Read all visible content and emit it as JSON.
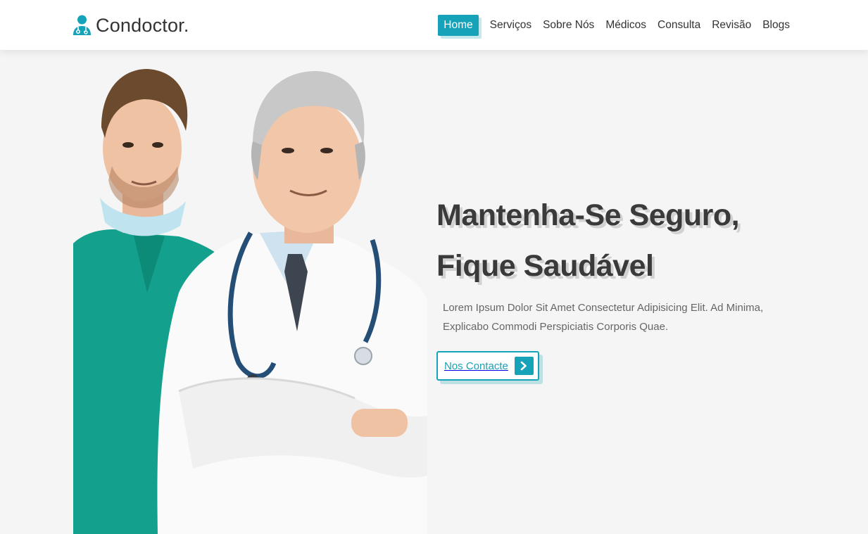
{
  "brand": {
    "name": "Condoctor.",
    "accent_color": "#16a2b8",
    "icon": "doctor-user-icon"
  },
  "nav": {
    "items": [
      {
        "label": "Home",
        "active": true
      },
      {
        "label": "Serviços",
        "active": false
      },
      {
        "label": "Sobre Nós",
        "active": false
      },
      {
        "label": "Médicos",
        "active": false
      },
      {
        "label": "Consulta",
        "active": false
      },
      {
        "label": "Revisão",
        "active": false
      },
      {
        "label": "Blogs",
        "active": false
      }
    ]
  },
  "hero": {
    "title_line1": "Mantenha-Se Seguro,",
    "title_line2": "Fique Saudável",
    "description": "Lorem Ipsum Dolor Sit Amet Consectetur Adipisicing Elit. Ad Minima, Explicabo Commodi Perspiciatis Corporis Quae.",
    "button_label": "Nos Contacte",
    "button_icon": "chevron-right-icon",
    "image": "two-doctors-photo"
  }
}
